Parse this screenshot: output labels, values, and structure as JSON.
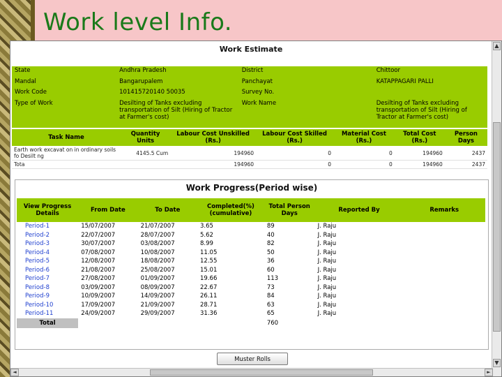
{
  "slide": {
    "title": "Work level Info."
  },
  "estimate": {
    "title": "Work Estimate",
    "info_left": [
      {
        "label": "State",
        "value": "Andhra Pradesh"
      },
      {
        "label": "Mandal",
        "value": "Bangarupalem"
      },
      {
        "label": "Work Code",
        "value": "101415720140 50035"
      },
      {
        "label": "Type of Work",
        "value": "Desilting of Tanks excluding transportation of Silt (Hiring of Tractor at Farmer's cost)"
      }
    ],
    "info_right": [
      {
        "label": "District",
        "value": "Chittoor"
      },
      {
        "label": "Panchayat",
        "value": "KATAPPAGARI PALLI"
      },
      {
        "label": "Survey No.",
        "value": ""
      },
      {
        "label": "Work Name",
        "value": "Desilting of Tanks excluding transportation of Silt (Hiring of Tractor at Farmer's cost)"
      }
    ],
    "task_headers": [
      "Task Name",
      "Quantity Units",
      "Labour Cost Unskilled (Rs.)",
      "Labour Cost Skilled (Rs.)",
      "Material Cost (Rs.)",
      "Total Cost (Rs.)",
      "Person Days"
    ],
    "tasks": [
      {
        "name": "Earth work excavat on in ordinary soils fo Desilt ng",
        "qty": "4145.5 Cum",
        "unskilled": "194960",
        "skilled": "0",
        "material": "0",
        "total": "194960",
        "days": "2437"
      },
      {
        "name": "Tota",
        "qty": "",
        "unskilled": "194960",
        "skilled": "0",
        "material": "0",
        "total": "194960",
        "days": "2437"
      }
    ]
  },
  "progress": {
    "title": "Work Progress(Period wise)",
    "headers": [
      "View Progress Details",
      "From Date",
      "To Date",
      "Completed(%) (cumulative)",
      "Total Person Days",
      "Reported By",
      "Remarks"
    ],
    "rows": [
      {
        "period": "Period-1",
        "from": "15/07/2007",
        "to": "21/07/2007",
        "completed": "3.65",
        "days": "89",
        "by": "J. Raju"
      },
      {
        "period": "Period-2",
        "from": "22/07/2007",
        "to": "28/07/2007",
        "completed": "5.62",
        "days": "40",
        "by": "J. Raju"
      },
      {
        "period": "Period-3",
        "from": "30/07/2007",
        "to": "03/08/2007",
        "completed": "8.99",
        "days": "82",
        "by": "J. Raju"
      },
      {
        "period": "Period-4",
        "from": "07/08/2007",
        "to": "10/08/2007",
        "completed": "11.05",
        "days": "50",
        "by": "J. Raju"
      },
      {
        "period": "Period-5",
        "from": "12/08/2007",
        "to": "18/08/2007",
        "completed": "12.55",
        "days": "36",
        "by": "J. Raju"
      },
      {
        "period": "Period-6",
        "from": "21/08/2007",
        "to": "25/08/2007",
        "completed": "15.01",
        "days": "60",
        "by": "J. Raju"
      },
      {
        "period": "Period-7",
        "from": "27/08/2007",
        "to": "01/09/2007",
        "completed": "19.66",
        "days": "113",
        "by": "J. Raju"
      },
      {
        "period": "Period-8",
        "from": "03/09/2007",
        "to": "08/09/2007",
        "completed": "22.67",
        "days": "73",
        "by": "J. Raju"
      },
      {
        "period": "Period-9",
        "from": "10/09/2007",
        "to": "14/09/2007",
        "completed": "26.11",
        "days": "84",
        "by": "J. Raju"
      },
      {
        "period": "Period-10",
        "from": "17/09/2007",
        "to": "21/09/2007",
        "completed": "28.71",
        "days": "63",
        "by": "J. Raju"
      },
      {
        "period": "Period-11",
        "from": "24/09/2007",
        "to": "29/09/2007",
        "completed": "31.36",
        "days": "65",
        "by": "J. Raju"
      }
    ],
    "total_label": "Total",
    "total_days": "760"
  },
  "muster_button": "Muster Rolls",
  "colors": {
    "header_green": "#99cc00",
    "link_blue": "#1f3fcf",
    "slide_bg": "#f7c6c8",
    "title_green": "#1a7a1a"
  }
}
